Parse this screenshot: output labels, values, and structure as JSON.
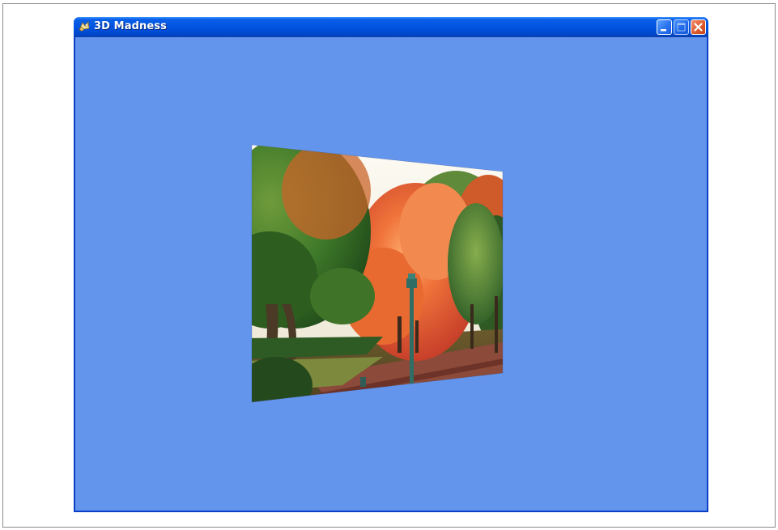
{
  "window": {
    "title": "3D Madness",
    "app_icon": "app-icon",
    "controls": {
      "minimize_icon": "minimize-icon",
      "maximize_icon": "maximize-icon",
      "close_icon": "close-icon",
      "maximize_enabled": false
    }
  },
  "client": {
    "background_color": "#6495ed",
    "content": "rotated-photo-plane"
  },
  "colors": {
    "titlebar": "#0255e0",
    "close_button": "#e15a2e"
  }
}
